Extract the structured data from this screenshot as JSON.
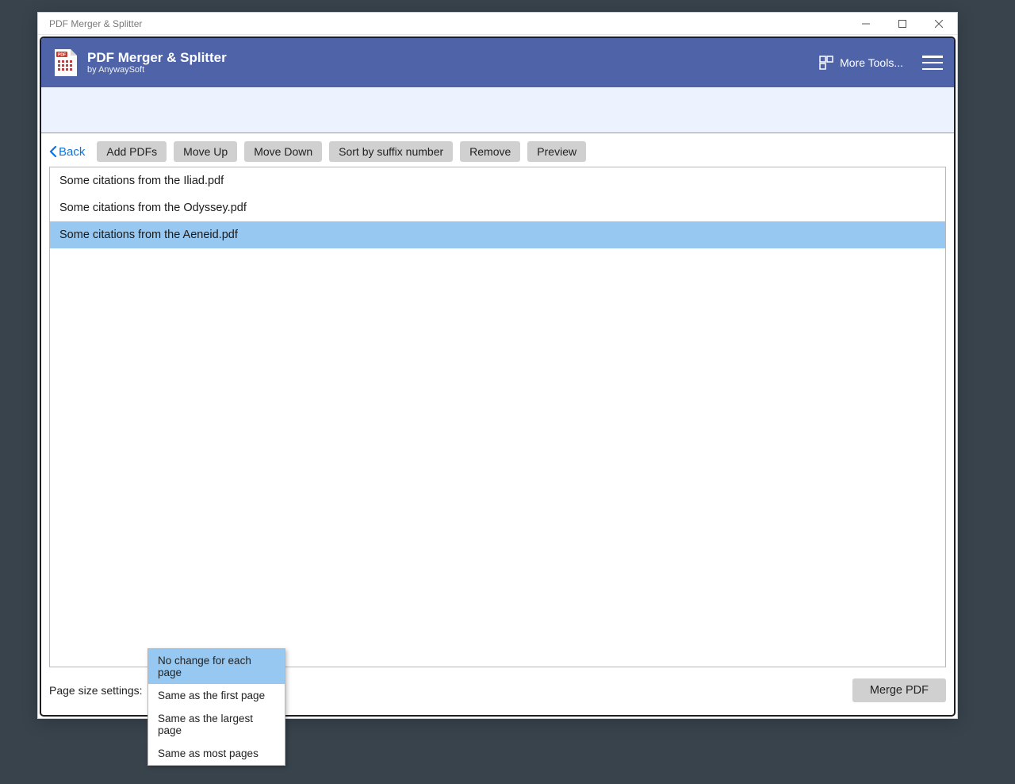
{
  "window": {
    "title": "PDF Merger & Splitter"
  },
  "header": {
    "title": "PDF Merger & Splitter",
    "subtitle": "by AnywaySoft",
    "more_tools_label": "More Tools..."
  },
  "toolbar": {
    "back_label": "Back",
    "buttons": [
      "Add PDFs",
      "Move Up",
      "Move Down",
      "Sort by suffix number",
      "Remove",
      "Preview"
    ]
  },
  "files": [
    {
      "name": "Some citations from the Iliad.pdf",
      "selected": false
    },
    {
      "name": "Some citations from the Odyssey.pdf",
      "selected": false
    },
    {
      "name": "Some citations from the Aeneid.pdf",
      "selected": true
    }
  ],
  "bottom": {
    "page_size_label": "Page size settings:",
    "merge_label": "Merge PDF"
  },
  "dropdown": {
    "items": [
      {
        "label": "No change for each page",
        "selected": true
      },
      {
        "label": "Same as the first page",
        "selected": false
      },
      {
        "label": "Same as the largest page",
        "selected": false
      },
      {
        "label": "Same as most pages",
        "selected": false
      }
    ]
  }
}
